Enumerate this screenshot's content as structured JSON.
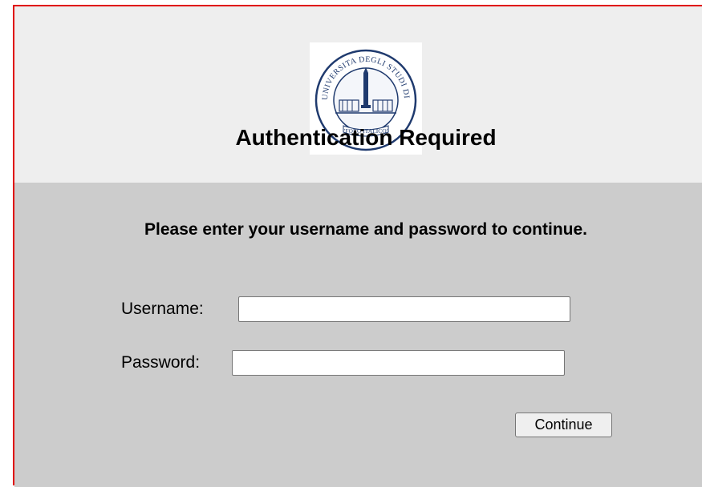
{
  "header": {
    "logo_icon": "university-seal-icon",
    "logo_text": "UNIVERSITA DEGLI STUDI DI ROMA \"FORO ITALICO\"",
    "title": "Authentication Required"
  },
  "form": {
    "prompt": "Please enter your username and password to continue.",
    "username_label": "Username:",
    "username_value": "",
    "password_label": "Password:",
    "password_value": "",
    "continue_label": "Continue"
  },
  "colors": {
    "header_bg": "#eeeeee",
    "body_bg": "#cccccc",
    "frame_border": "#e00000",
    "seal_blue": "#1f3a6e"
  }
}
